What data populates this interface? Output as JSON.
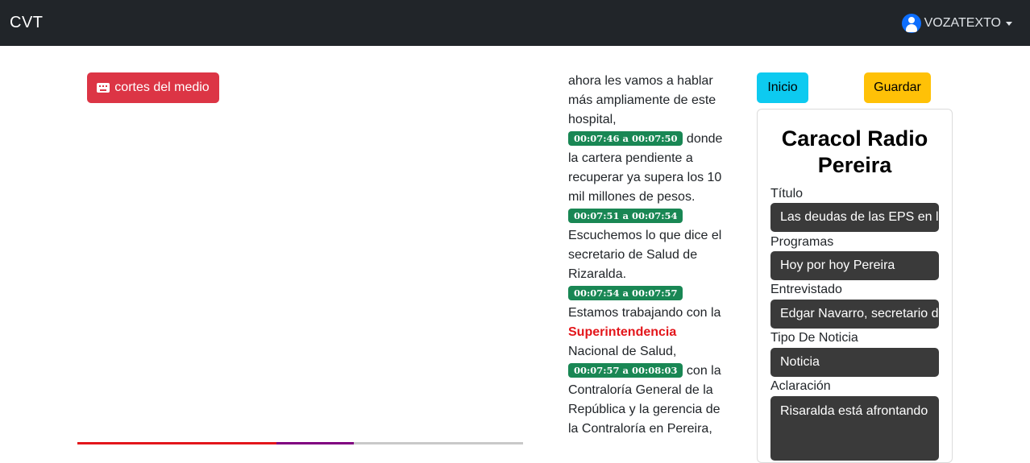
{
  "navbar": {
    "brand": "CVT",
    "user": "VOZATEXTO"
  },
  "left_panel": {
    "cortes_button": "cortes del medio",
    "playback_progress": 0.62
  },
  "transcript": {
    "lines": {
      "l0": "ahora les vamos a hablar más ampliamente de este hospital,",
      "t1": "00:07:46 a 00:07:50",
      "l1": "donde la cartera pendiente a recuperar ya supera los 10 mil millones de pesos.",
      "t2": "00:07:51 a 00:07:54",
      "l2": "Escuchemos lo que dice el secretario de Salud de Rizaralda.",
      "t3": "00:07:54 a 00:07:57",
      "l3a": "Estamos trabajando con la",
      "l3hl": "Superintendencia",
      "l3b": "Nacional de Salud,",
      "t4": "00:07:57 a 00:08:03",
      "l4": "con la Contraloría General de la República y la gerencia de la Contraloría en Pereira,"
    }
  },
  "actions": {
    "inicio": "Inicio",
    "guardar": "Guardar"
  },
  "card": {
    "title": "Caracol Radio Pereira",
    "titulo_label": "Título",
    "titulo_value": "Las deudas de las EPS en la",
    "programas_label": "Programas",
    "programas_value": "Hoy por hoy Pereira",
    "entrevistado_label": "Entrevistado",
    "entrevistado_value": "Edgar Navarro, secretario de",
    "tipo_label": "Tipo De Noticia",
    "tipo_value": "Noticia",
    "aclaracion_label": "Aclaración",
    "aclaracion_value": "Risaralda está afrontando"
  },
  "colors": {
    "navbar": "#212529",
    "danger": "#dc3545",
    "success": "#198754",
    "info": "#0dcaf0",
    "warning": "#ffc107",
    "highlight": "#e3161b"
  }
}
